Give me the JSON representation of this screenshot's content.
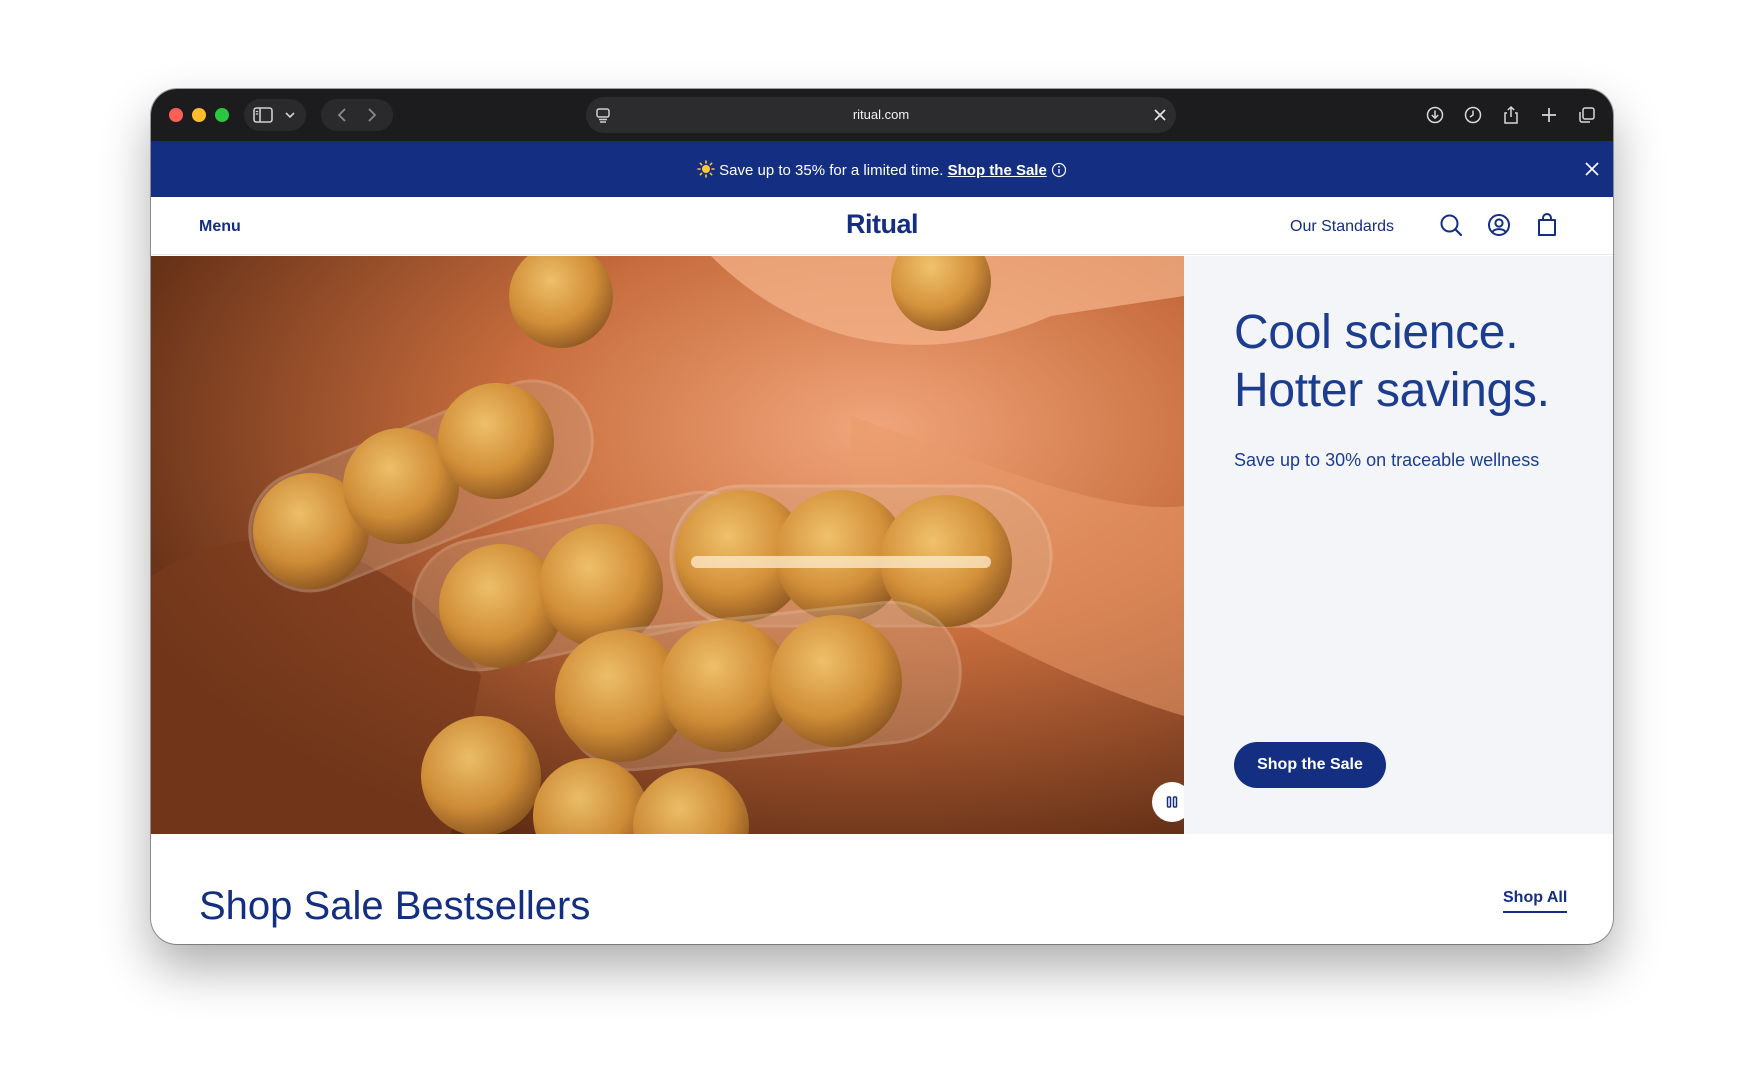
{
  "browser": {
    "url": "ritual.com",
    "toolbar_icons": [
      "sidebar-icon",
      "chevron-down-icon",
      "back-icon",
      "forward-icon",
      "download-icon",
      "history-icon",
      "share-icon",
      "new-tab-icon",
      "tabs-overview-icon"
    ]
  },
  "promo": {
    "text": "Save up to 35% for a limited time.",
    "link": "Shop the Sale"
  },
  "nav": {
    "menu": "Menu",
    "logo": "Ritual",
    "standards": "Our Standards"
  },
  "hero": {
    "title_line1": "Cool science.",
    "title_line2": "Hotter savings.",
    "subtitle": "Save up to 30% on traceable wellness",
    "cta": "Shop the Sale"
  },
  "section": {
    "title": "Shop Sale Bestsellers",
    "link": "Shop All"
  },
  "colors": {
    "brand_navy": "#142e82",
    "hero_text": "#1c3d8f",
    "hero_panel_bg": "#f4f5f9"
  }
}
